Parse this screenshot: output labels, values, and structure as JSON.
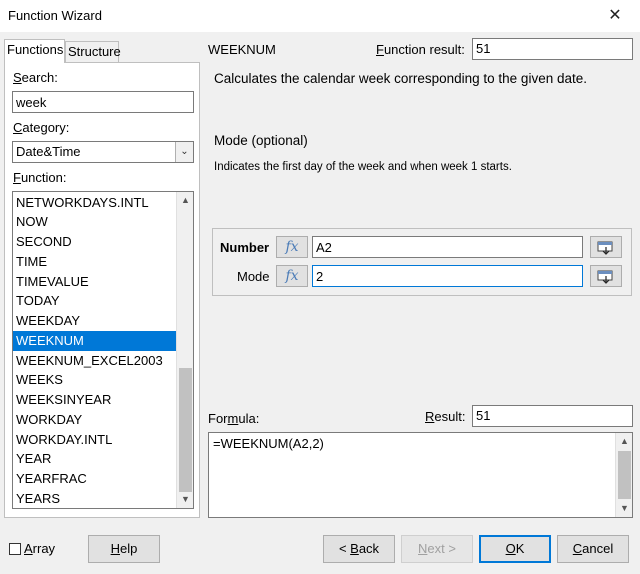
{
  "window": {
    "title": "Function Wizard",
    "close_glyph": "✕"
  },
  "tabs": [
    {
      "label": "Functions",
      "active": true
    },
    {
      "label": "Structure",
      "active": false
    }
  ],
  "search": {
    "label": "Search:",
    "value": "week"
  },
  "category": {
    "label": "Category:",
    "value": "Date&Time"
  },
  "function_list": {
    "label": "Function:",
    "items": [
      "NETWORKDAYS.INTL",
      "NOW",
      "SECOND",
      "TIME",
      "TIMEVALUE",
      "TODAY",
      "WEEKDAY",
      "WEEKNUM",
      "WEEKNUM_EXCEL2003",
      "WEEKS",
      "WEEKSINYEAR",
      "WORKDAY",
      "WORKDAY.INTL",
      "YEAR",
      "YEARFRAC",
      "YEARS"
    ],
    "selected": "WEEKNUM"
  },
  "detail": {
    "function_name": "WEEKNUM",
    "function_result_label": "Function result:",
    "function_result_value": "51",
    "description": "Calculates the calendar week corresponding to the given date.",
    "param_title": "Mode (optional)",
    "param_description": "Indicates the first day of the week and when week 1 starts."
  },
  "arguments": [
    {
      "label": "Number",
      "value": "A2",
      "bold": true
    },
    {
      "label": "Mode",
      "value": "2",
      "bold": false
    }
  ],
  "fx_glyph": "fx",
  "formula": {
    "label": "Formula:",
    "value": "=WEEKNUM(A2,2)"
  },
  "result": {
    "label": "Result:",
    "value": "51"
  },
  "buttons": {
    "array": "Array",
    "help": "Help",
    "back": "< Back",
    "next": "Next >",
    "ok": "OK",
    "cancel": "Cancel"
  },
  "colors": {
    "selection": "#0078d7",
    "fx": "#4a7bb7"
  }
}
